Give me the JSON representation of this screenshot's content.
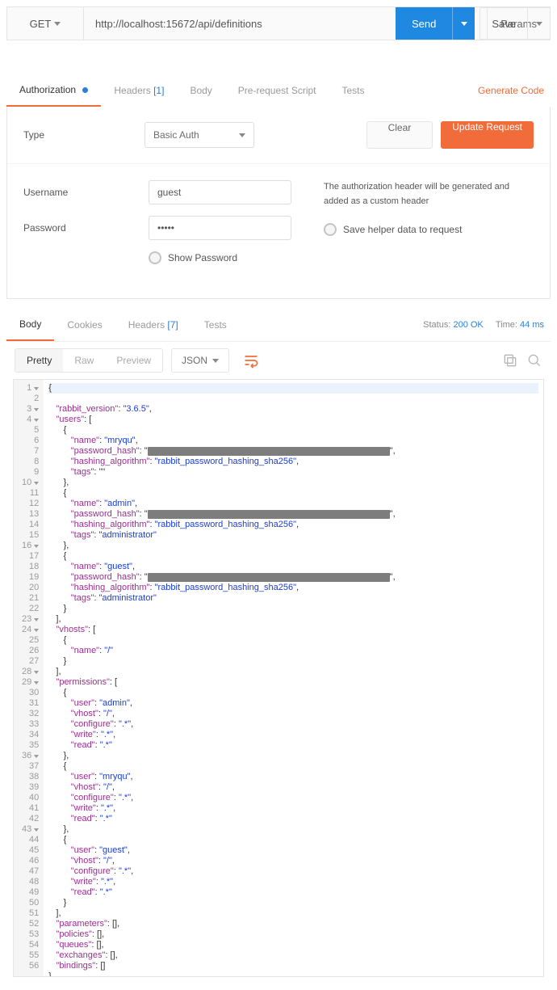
{
  "request": {
    "method": "GET",
    "url": "http://localhost:15672/api/definitions",
    "params_button": "Params",
    "send_button": "Send",
    "save_button": "Save"
  },
  "request_tabs": {
    "authorization": "Authorization",
    "headers": "Headers",
    "headers_badge": "[1]",
    "body": "Body",
    "prerequest": "Pre-request Script",
    "tests": "Tests",
    "generate_code": "Generate Code"
  },
  "auth": {
    "type_label": "Type",
    "type_value": "Basic Auth",
    "clear": "Clear",
    "update": "Update Request",
    "username_label": "Username",
    "username_value": "guest",
    "password_label": "Password",
    "password_value": "•••••",
    "show_password": "Show Password",
    "hint": "The authorization header will be generated and added as a custom header",
    "save_helper": "Save helper data to request"
  },
  "response": {
    "tabs": {
      "body": "Body",
      "cookies": "Cookies",
      "headers": "Headers",
      "headers_badge": "[7]",
      "tests": "Tests"
    },
    "status_label": "Status:",
    "status_value": "200 OK",
    "time_label": "Time:",
    "time_value": "44 ms",
    "pretty_tabs": {
      "pretty": "Pretty",
      "raw": "Raw",
      "preview": "Preview"
    },
    "format": "JSON"
  },
  "json_body": {
    "rabbit_version": "3.6.5",
    "users": [
      {
        "name": "mryqu",
        "password_hash": "[redacted]",
        "hashing_algorithm": "rabbit_password_hashing_sha256",
        "tags": ""
      },
      {
        "name": "admin",
        "password_hash": "[redacted]",
        "hashing_algorithm": "rabbit_password_hashing_sha256",
        "tags": "administrator"
      },
      {
        "name": "guest",
        "password_hash": "[redacted]",
        "hashing_algorithm": "rabbit_password_hashing_sha256",
        "tags": "administrator"
      }
    ],
    "vhosts": [
      {
        "name": "/"
      }
    ],
    "permissions": [
      {
        "user": "admin",
        "vhost": "/",
        "configure": ".*",
        "write": ".*",
        "read": ".*"
      },
      {
        "user": "mryqu",
        "vhost": "/",
        "configure": ".*",
        "write": ".*",
        "read": ".*"
      },
      {
        "user": "guest",
        "vhost": "/",
        "configure": ".*",
        "write": ".*",
        "read": ".*"
      }
    ],
    "parameters": [],
    "policies": [],
    "queues": [],
    "exchanges": [],
    "bindings": []
  },
  "line_count": 56,
  "fold_lines": [
    1,
    3,
    4,
    10,
    16,
    23,
    24,
    28,
    29,
    36,
    43
  ]
}
